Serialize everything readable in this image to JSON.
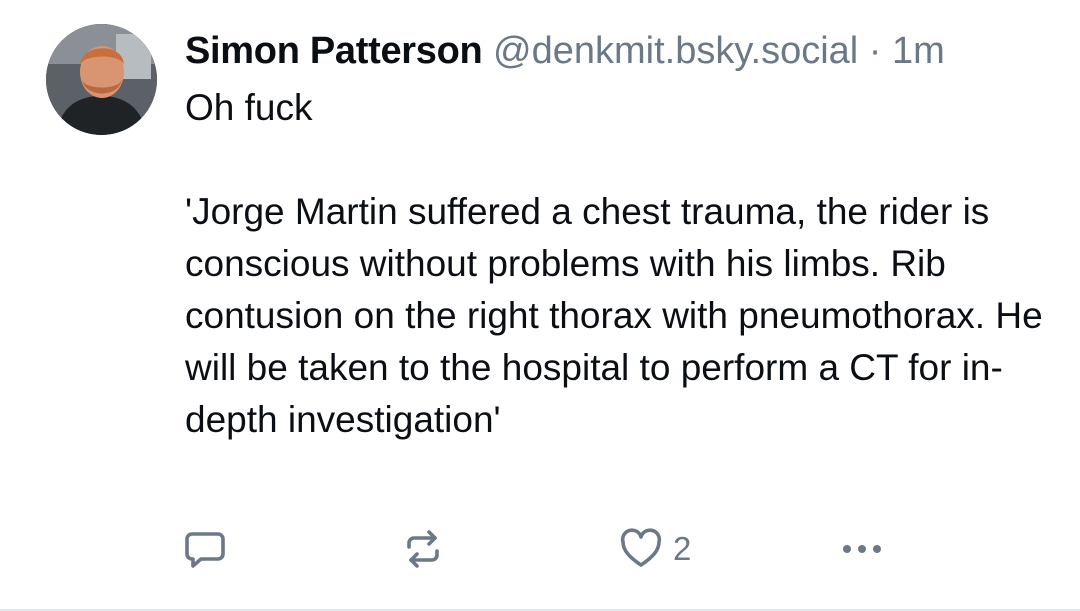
{
  "post": {
    "display_name": "Simon Patterson",
    "handle": "@denkmit.bsky.social",
    "separator": "·",
    "time": "1m",
    "text": "Oh fuck\n\n'Jorge Martin suffered a chest trauma, the rider is conscious without problems with his limbs. Rib contusion on the right thorax with pneumothorax. He will be taken to the hospital to perform a CT for in-depth investigation'"
  },
  "actions": {
    "reply_icon": "speech-bubble-icon",
    "repost_icon": "repost-arrows-icon",
    "like_icon": "heart-icon",
    "like_count": "2",
    "more_icon": "ellipsis-icon"
  },
  "colors": {
    "text": "#0b0f14",
    "muted": "#6b7887",
    "divider": "#e4e8ec"
  }
}
